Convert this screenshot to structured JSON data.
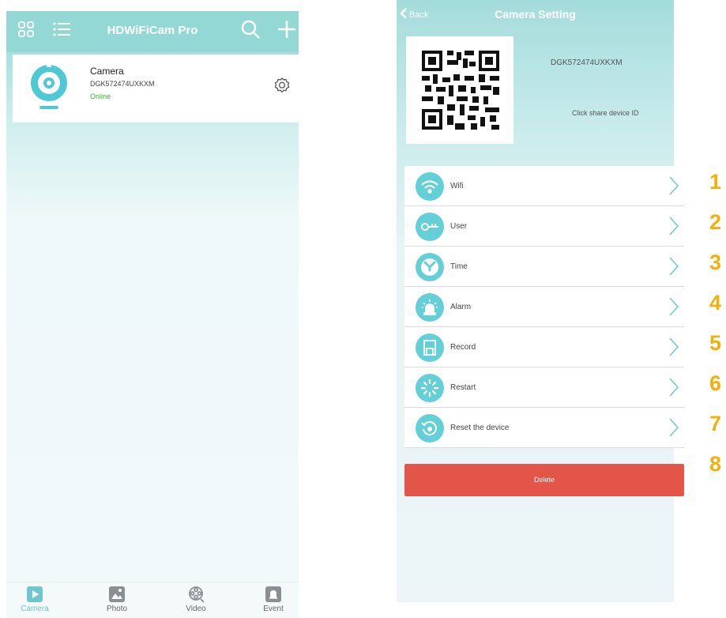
{
  "left_screen": {
    "title": "HDWiFiCam Pro",
    "icons": [
      "grid-view-icon",
      "list-view-icon",
      "search-icon",
      "add-icon"
    ],
    "camera": {
      "name": "Camera",
      "device_id": "DGK572474UXKXM",
      "status": "Online",
      "status_color": "#3aaa35"
    },
    "tabs": [
      {
        "label": "Camera",
        "icon": "play-icon",
        "active": true
      },
      {
        "label": "Photo",
        "icon": "photo-icon",
        "active": false
      },
      {
        "label": "Video",
        "icon": "film-reel-icon",
        "active": false
      },
      {
        "label": "Event",
        "icon": "bell-icon",
        "active": false
      }
    ]
  },
  "right_screen": {
    "back_label": "Back",
    "title": "Camera Setting",
    "device_id": "DGK572474UXKXM",
    "share_text": "Click share device ID",
    "menu": [
      {
        "label": "Wifi",
        "icon": "wifi-icon"
      },
      {
        "label": "User",
        "icon": "key-icon"
      },
      {
        "label": "Time",
        "icon": "clock-icon"
      },
      {
        "label": "Alarm",
        "icon": "alarm-light-icon"
      },
      {
        "label": "Record",
        "icon": "sd-card-icon"
      },
      {
        "label": "Restart",
        "icon": "restart-icon"
      },
      {
        "label": "Reset the device",
        "icon": "reset-icon"
      }
    ],
    "delete_label": "Delete",
    "accent_color": "#64cfd6",
    "delete_color": "#e35548"
  },
  "annotation_numbers": [
    "1",
    "2",
    "3",
    "4",
    "5",
    "6",
    "7",
    "8"
  ]
}
